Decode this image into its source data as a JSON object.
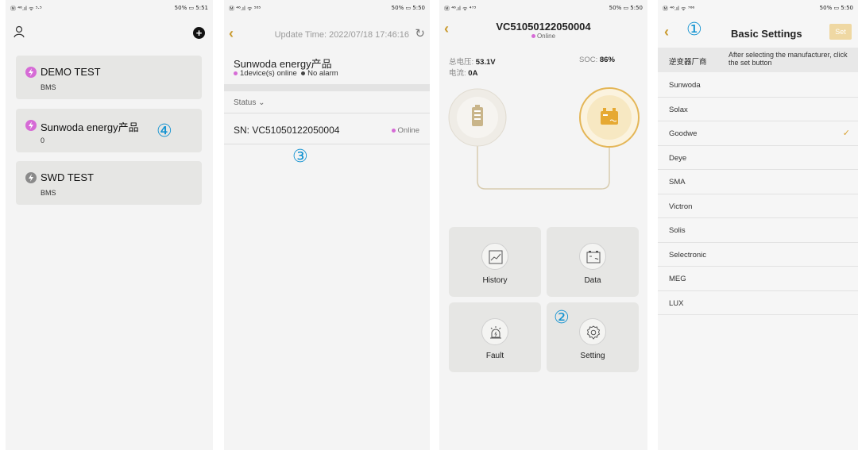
{
  "screen1": {
    "status_left": "Ⓜ ⁴⁶.ıl ᯤ ⁵·⁵",
    "status_right": "50% ▭ 5:51",
    "devices": [
      {
        "name": "DEMO TEST",
        "sub": "BMS",
        "color": "#d66bd6"
      },
      {
        "name": "Sunwoda energy产品",
        "sub": "0",
        "color": "#d66bd6"
      },
      {
        "name": "SWD TEST",
        "sub": "BMS",
        "color": "#8a8a8a"
      }
    ],
    "annotation": "④"
  },
  "screen2": {
    "status_left": "Ⓜ ⁴⁶.ıl ᯤ ⁵⁸⁵",
    "status_right": "50% ▭ 5:50",
    "update_time": "Update Time:  2022/07/18 17:46:16",
    "project_name": "Sunwoda energy产品",
    "online_text": "1device(s) online",
    "alarm_text": "No alarm",
    "status_label": "Status",
    "sn_text": "SN:  VC51050122050004",
    "sn_status": "Online",
    "annotation": "③"
  },
  "screen3": {
    "status_left": "Ⓜ ⁴⁶.ıl ᯤ ⁴⁷³",
    "status_right": "50% ▭ 5:50",
    "device_id": "VC51050122050004",
    "status": "Online",
    "voltage_label": "总电压:",
    "voltage_value": "53.1V",
    "current_label": "电流:",
    "current_value": "0A",
    "soc_label": "SOC:",
    "soc_value": "86%",
    "tiles": [
      "History",
      "Data",
      "Fault",
      "Setting"
    ],
    "annotation": "②"
  },
  "screen4": {
    "status_left": "Ⓜ ⁴⁶.ıl ᯤ ⁷⁶⁶",
    "status_right": "50% ▭ 5:50",
    "title": "Basic Settings",
    "set_label": "Set",
    "manufacturer_label": "逆变器厂商",
    "hint": "After selecting the manufacturer, click the set button",
    "manufacturers": [
      "Sunwoda",
      "Solax",
      "Goodwe",
      "Deye",
      "SMA",
      "Victron",
      "Solis",
      "Selectronic",
      "MEG",
      "LUX"
    ],
    "selected": "Goodwe",
    "annotation": "①"
  },
  "colors": {
    "accent": "#c99a2e",
    "online": "#d66bd6",
    "annotation": "#1493d1"
  }
}
